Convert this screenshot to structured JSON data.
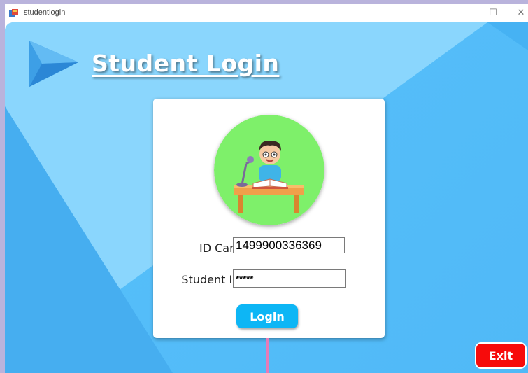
{
  "window": {
    "title": "studentlogin",
    "minimize_glyph": "—",
    "maximize_glyph": "☐",
    "close_glyph": "✕"
  },
  "header": {
    "title": "Student Login",
    "arrow_icon": "play-arrow-icon"
  },
  "form": {
    "avatar_icon": "student-reading-illustration",
    "id_card_label": "ID Card :",
    "id_card_value": "1499900336369",
    "student_id_label": "Student ID :",
    "student_id_value": "*****",
    "login_label": "Login"
  },
  "footer": {
    "exit_label": "Exit"
  },
  "colors": {
    "background": "#50b9f7",
    "login_button": "#0db6f5",
    "exit_button": "#f70b0b",
    "avatar_bg": "#7ef06a"
  }
}
